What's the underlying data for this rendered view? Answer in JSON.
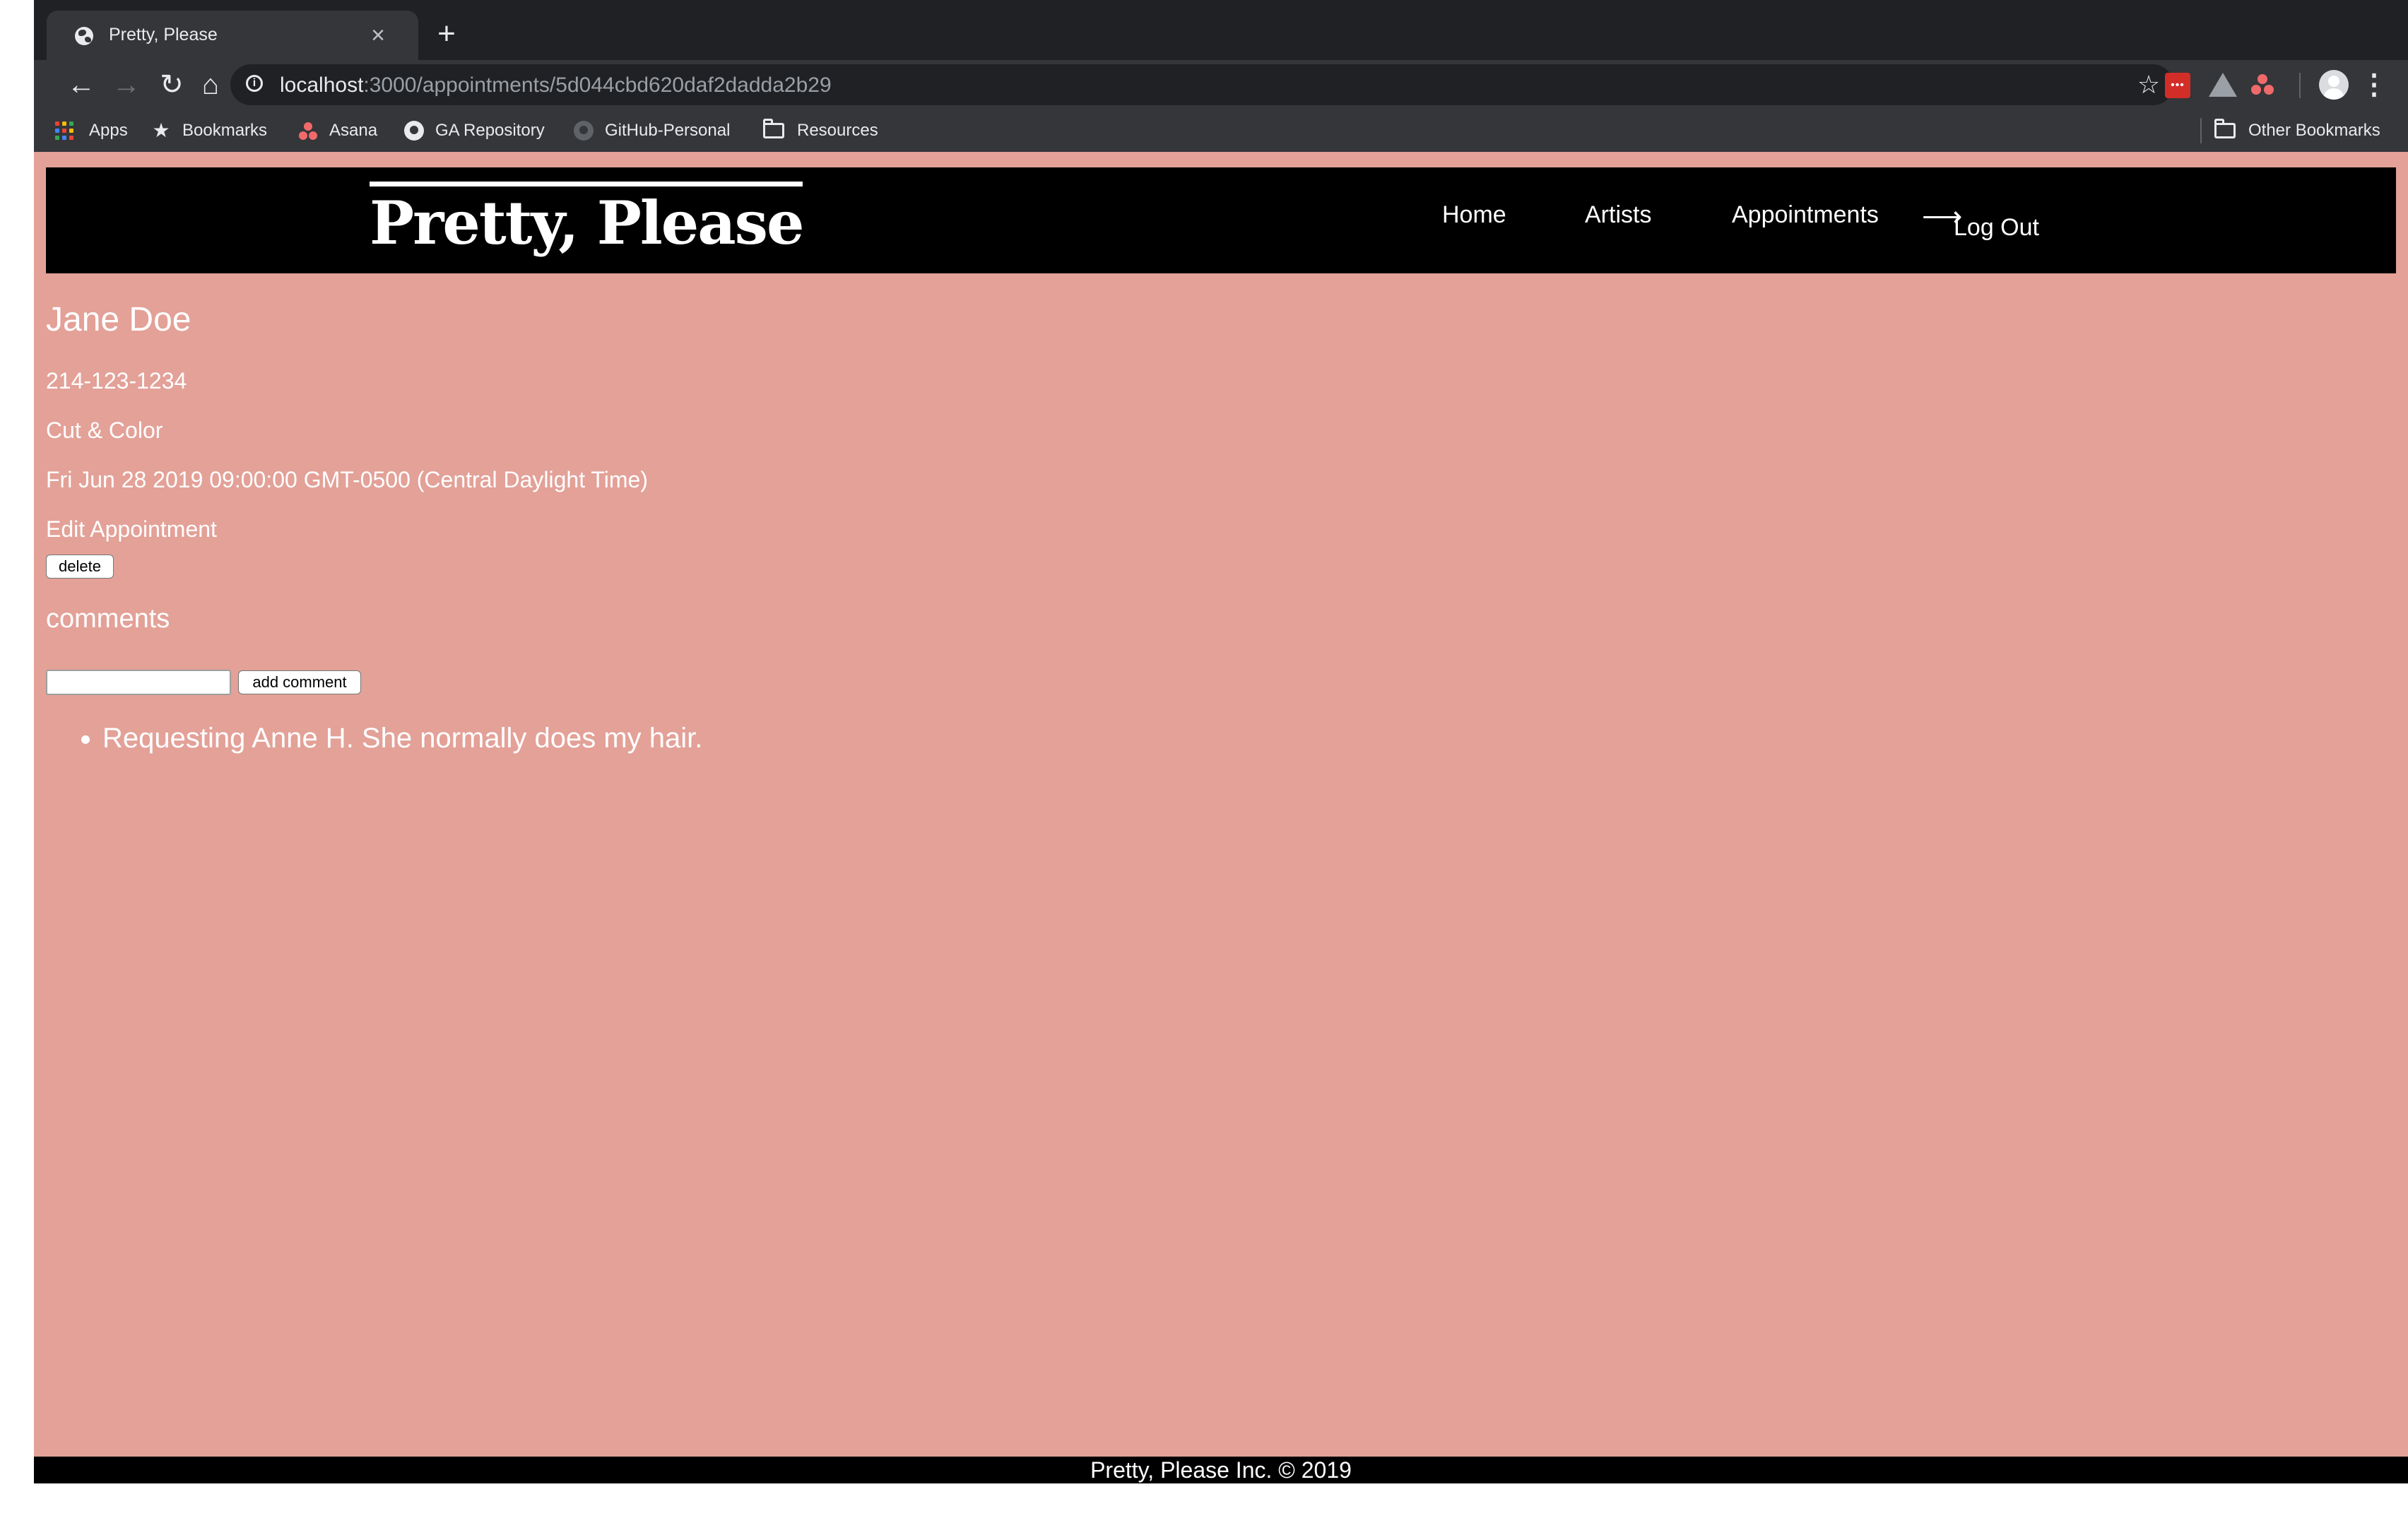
{
  "browser": {
    "tab_title": "Pretty, Please",
    "url_host": "localhost",
    "url_path": ":3000/appointments/5d044cbd620daf2dadda2b29",
    "bookmarks": [
      {
        "label": "Apps"
      },
      {
        "label": "Bookmarks"
      },
      {
        "label": "Asana"
      },
      {
        "label": "GA Repository"
      },
      {
        "label": "GitHub-Personal"
      },
      {
        "label": "Resources"
      }
    ],
    "other_bookmarks": "Other Bookmarks"
  },
  "site": {
    "logo": "Pretty, Please",
    "nav": {
      "home": "Home",
      "artists": "Artists",
      "appointments": "Appointments",
      "logout": "Log Out"
    },
    "footer": "Pretty, Please Inc. © 2019"
  },
  "appointment": {
    "client_name": "Jane Doe",
    "phone": "214-123-1234",
    "service": "Cut & Color",
    "date": "Fri Jun 28 2019 09:00:00 GMT-0500 (Central Daylight Time)",
    "edit_link": "Edit Appointment",
    "delete_label": "delete"
  },
  "comments": {
    "title": "comments",
    "input_value": "",
    "add_label": "add comment",
    "items": [
      "Requesting Anne H. She normally does my hair."
    ]
  },
  "colors": {
    "page_background": "#e3a198",
    "header_background": "#000000",
    "text": "#ffffff"
  }
}
